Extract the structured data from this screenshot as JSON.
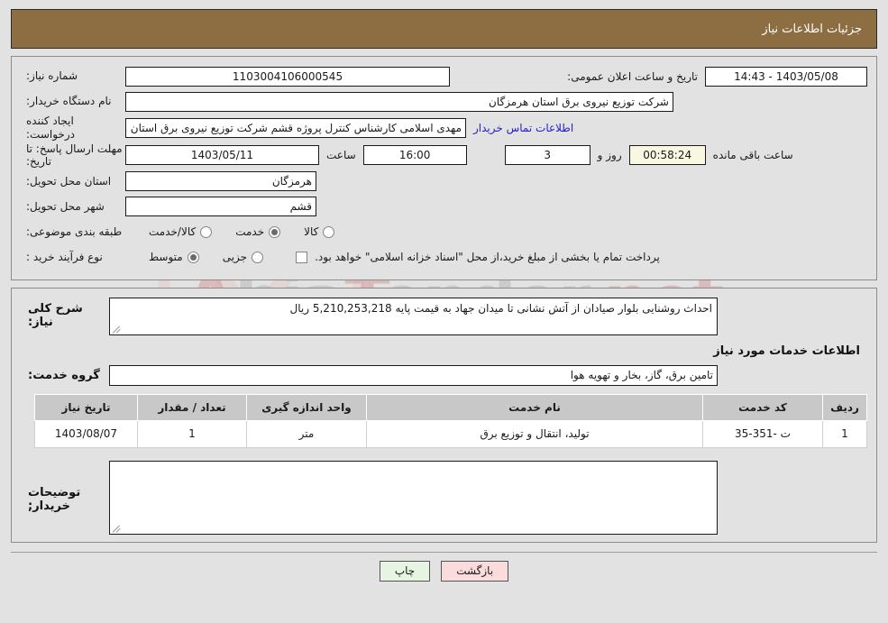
{
  "header": {
    "title": "جزئیات اطلاعات نیاز"
  },
  "watermark": {
    "text_left": "Ahia",
    "text_mid": "Tender",
    "text_right": ".net"
  },
  "form": {
    "need_number": {
      "label": "شماره نیاز:",
      "value": "1103004106000545"
    },
    "buyer_org": {
      "label": "نام دستگاه خریدار:",
      "value": "شرکت توزیع نیروی برق استان هرمزگان"
    },
    "creator": {
      "label": "ایجاد کننده درخواست:",
      "value": "مهدی اسلامی کارشناس کنترل پروژه قشم شرکت توزیع نیروی برق استان هرمز",
      "contact_link": "اطلاعات تماس خریدار"
    },
    "announce": {
      "label": "تاریخ و ساعت اعلان عمومی:",
      "value": "1403/05/08 - 14:43"
    },
    "deadline": {
      "label": "مهلت ارسال پاسخ: تا تاریخ:",
      "date": "1403/05/11",
      "hour_label": "ساعت",
      "hour": "16:00",
      "days": "3",
      "days_label": "روز و",
      "clock": "00:58:24",
      "remaining_label": "ساعت باقی مانده"
    },
    "province": {
      "label": "استان محل تحویل:",
      "value": "هرمزگان"
    },
    "city": {
      "label": "شهر محل تحویل:",
      "value": "قشم"
    },
    "category": {
      "label": "طبقه بندی موضوعی:",
      "options": [
        "کالا",
        "خدمت",
        "کالا/خدمت"
      ],
      "selected": "خدمت"
    },
    "purchase_type": {
      "label": "نوع فرآیند خرید :",
      "options": [
        "جزیی",
        "متوسط"
      ],
      "selected": "متوسط",
      "checkbox_note": "پرداخت تمام یا بخشی از مبلغ خرید،از محل \"اسناد خزانه اسلامی\" خواهد بود.",
      "checkbox_checked": false
    }
  },
  "details": {
    "general_desc": {
      "label": "شرح کلی نیاز:",
      "value": "احداث روشنایی بلوار صیادان از آتش نشانی تا میدان جهاد به قیمت پایه  5,210,253,218 ریال"
    },
    "services_section_title": "اطلاعات خدمات مورد نیاز",
    "service_group": {
      "label": "گروه خدمت:",
      "value": "تامین برق، گاز، بخار و تهویه هوا"
    },
    "table": {
      "columns": [
        "ردیف",
        "کد خدمت",
        "نام خدمت",
        "واحد اندازه گیری",
        "تعداد / مقدار",
        "تاریخ نیاز"
      ],
      "rows": [
        {
          "radif": "1",
          "code": "ت -351-35",
          "name": "تولید، انتقال و توزیع برق",
          "unit": "متر",
          "qty": "1",
          "date": "1403/08/07"
        }
      ]
    },
    "buyer_notes": {
      "label": "توضیحات خریدار;",
      "value": ""
    }
  },
  "buttons": {
    "print": "چاپ",
    "back": "بازگشت"
  },
  "colors": {
    "header_brown": "#8d6e42",
    "page_bg": "#e2e2e2",
    "link_blue": "#2222cc",
    "print_green": "#e6f5e2",
    "back_pink": "#fadcdc",
    "timer_cream": "#f9f7e2",
    "table_header_gray": "#c8c8c8"
  }
}
